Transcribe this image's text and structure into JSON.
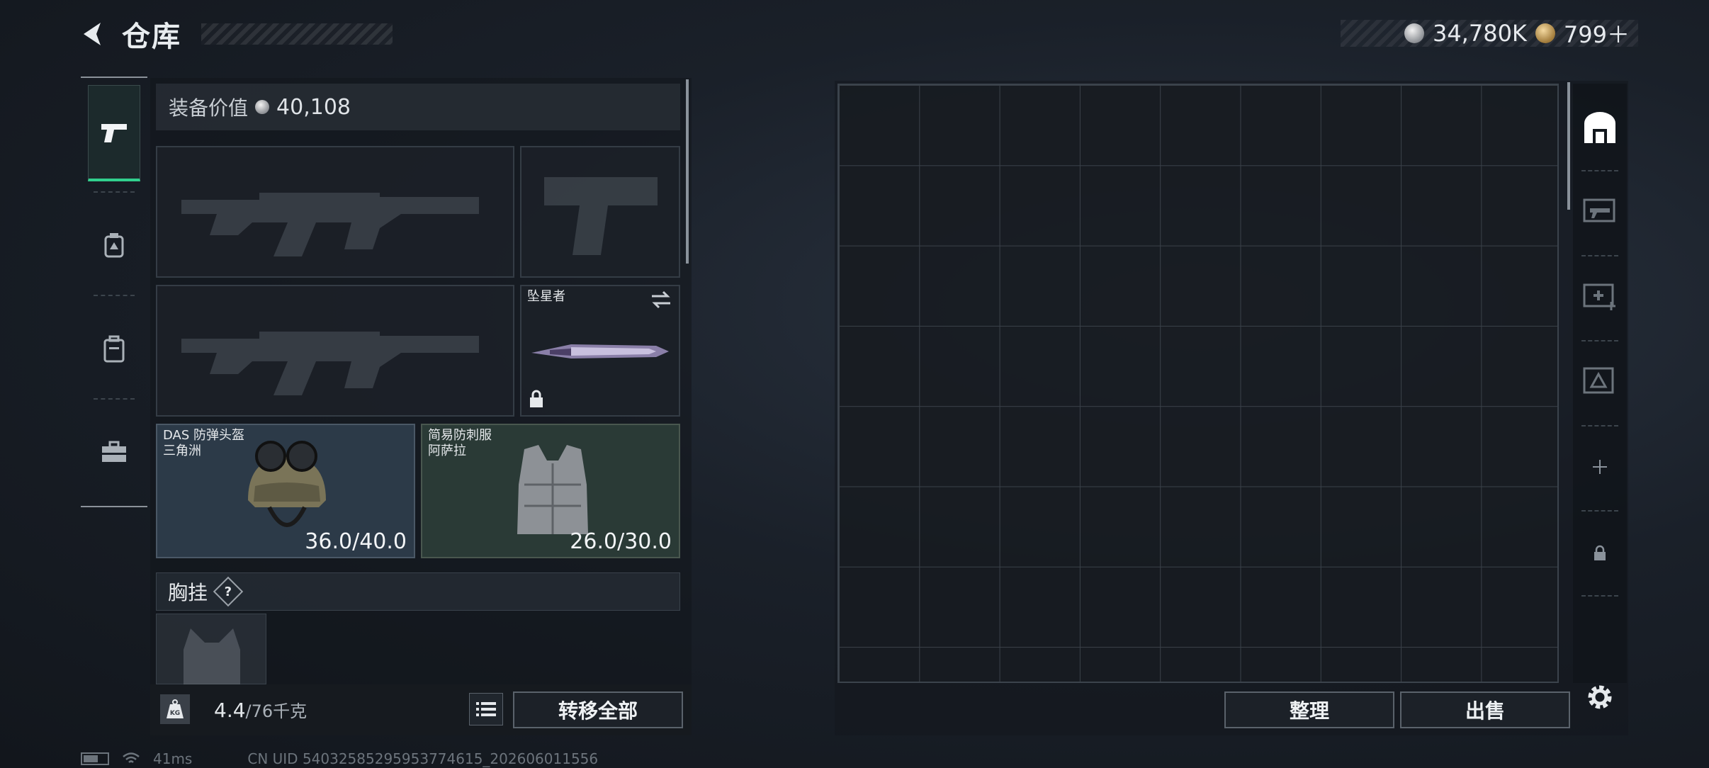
{
  "header": {
    "title": "仓库",
    "currencies": [
      {
        "name": "silver",
        "value": "34,780K"
      },
      {
        "name": "gold",
        "value": "799＋"
      }
    ]
  },
  "rail": {
    "items": [
      {
        "name": "weapons",
        "icon": "pistol-icon",
        "active": true
      },
      {
        "name": "ammo-pouch",
        "icon": "pouch-icon",
        "active": false
      },
      {
        "name": "backpack",
        "icon": "backpack-icon",
        "active": false
      },
      {
        "name": "toolbox",
        "icon": "toolbox-icon",
        "active": false
      }
    ]
  },
  "equipment": {
    "value_label": "装备价值",
    "value": "40,108",
    "melee": {
      "name": "坠星者"
    },
    "helmet": {
      "name": "DAS 防弹头盔",
      "sub": "三角洲",
      "durability": "36.0/40.0"
    },
    "armor": {
      "name": "简易防刺服",
      "sub": "阿萨拉",
      "durability": "26.0/30.0"
    },
    "rig_section": {
      "title": "胸挂",
      "help": "?"
    }
  },
  "footer_left": {
    "weight": "4.4",
    "capacity": "/76千克",
    "weight_icon_text": "KG",
    "transfer_label": "转移全部"
  },
  "storage": {
    "sort_label": "整理",
    "sell_label": "出售"
  },
  "side_tabs": [
    {
      "icon": "storage-icon",
      "active": true
    },
    {
      "icon": "weapon-case-icon",
      "active": false
    },
    {
      "icon": "medical-case-icon",
      "active": false
    },
    {
      "icon": "ammo-case-icon",
      "active": false
    },
    {
      "icon": "add-icon",
      "active": false
    },
    {
      "icon": "lock-icon",
      "active": false
    }
  ],
  "status_bar": {
    "ping": "41ms",
    "uid": "CN UID 54032585295953774615_202606011556"
  },
  "colors": {
    "accent": "#31d08e",
    "helmet_bg": "#2c3a48",
    "armor_bg": "#2a3a36"
  }
}
